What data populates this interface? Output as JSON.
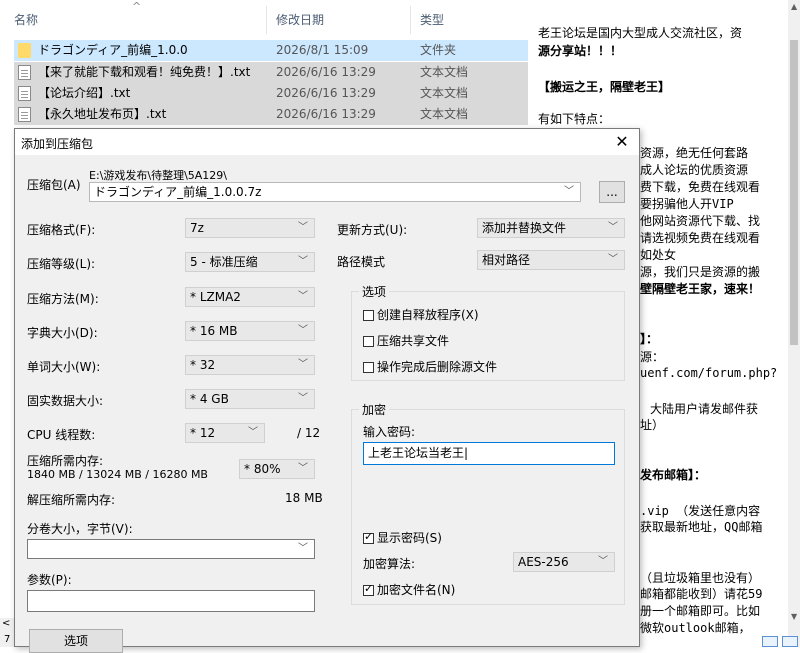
{
  "explorer": {
    "headers": {
      "name": "名称",
      "modified": "修改日期",
      "type": "类型"
    },
    "rows": [
      {
        "name": "ドラゴンディア_前编_1.0.0",
        "date": "2026/8/1 15:09",
        "type": "文件夹",
        "icon": "folder-icon"
      },
      {
        "name": "【来了就能下载和观看！纯免费！】.txt",
        "date": "2026/6/16 13:29",
        "type": "文本文档",
        "icon": "text-file-icon"
      },
      {
        "name": "【论坛介绍】.txt",
        "date": "2026/6/16 13:29",
        "type": "文本文档",
        "icon": "text-file-icon"
      },
      {
        "name": "【永久地址发布页】.txt",
        "date": "2026/6/16 13:29",
        "type": "文本文档",
        "icon": "text-file-icon"
      }
    ],
    "status_left": "7"
  },
  "preview": {
    "lines_top": [
      "老王论坛是国内大型成人交流社区，资",
      "源分享站！！！",
      "【搬运之王，隔壁老王】",
      "有如下特点："
    ],
    "lines_side": [
      "资源，绝无任何套路",
      "成人论坛的优质资源",
      "费下载，免费在线观看",
      "要拐骗他人开VIP",
      "他网站资源代下载、找",
      "请选视频免费在线观看",
      "如处女",
      "源，我们只是资源的搬",
      "壁隔壁老王家，速来！",
      "】：",
      "源：",
      "uenf.com/forum.php?",
      "大陆用户请发邮件获",
      "址）",
      "发布邮箱】：",
      ".vip  （发送任意内容",
      "获取最新地址，QQ邮箱",
      "（且垃圾箱里也没有）",
      "邮箱都能收到）请花59",
      "册一个邮箱即可。比如",
      "微软outlook邮箱，"
    ]
  },
  "dialog": {
    "title": "添加到压缩包",
    "close": "✕",
    "archive_label": "压缩包(A)",
    "archive_path": "E:\\游戏发布\\待整理\\5A129\\",
    "archive_name": "ドラゴンディア_前编_1.0.0.7z",
    "browse": "...",
    "left": [
      {
        "label": "压缩格式(F):",
        "value": "7z"
      },
      {
        "label": "压缩等级(L):",
        "value": "5 - 标准压缩"
      },
      {
        "label": "压缩方法(M):",
        "value": "* LZMA2"
      },
      {
        "label": "字典大小(D):",
        "value": "* 16 MB"
      },
      {
        "label": "单词大小(W):",
        "value": "* 32"
      },
      {
        "label": "固实数据大小:",
        "value": "* 4 GB"
      }
    ],
    "cpu_label": "CPU 线程数:",
    "cpu_value": "* 12",
    "cpu_total": "/ 12",
    "mem_label": "压缩所需内存:",
    "mem_detail": "1840 MB / 13024 MB / 16280 MB",
    "mem_value": "* 80%",
    "decomp_label": "解压缩所需内存:",
    "decomp_value": "18 MB",
    "split_label": "分卷大小，字节(V):",
    "params_label": "参数(P):",
    "options_button": "选项",
    "update_label": "更新方式(U):",
    "update_value": "添加并替换文件",
    "path_label": "路径模式",
    "path_value": "相对路径",
    "options_group": "选项",
    "opt_sfx": "创建自释放程序(X)",
    "opt_shared": "压缩共享文件",
    "opt_delete": "操作完成后删除源文件",
    "encrypt_group": "加密",
    "password_label": "输入密码:",
    "password_value": "上老王论坛当老王",
    "show_password": "显示密码(S)",
    "method_label": "加密算法:",
    "method_value": "AES-256",
    "encrypt_names": "加密文件名(N)"
  }
}
